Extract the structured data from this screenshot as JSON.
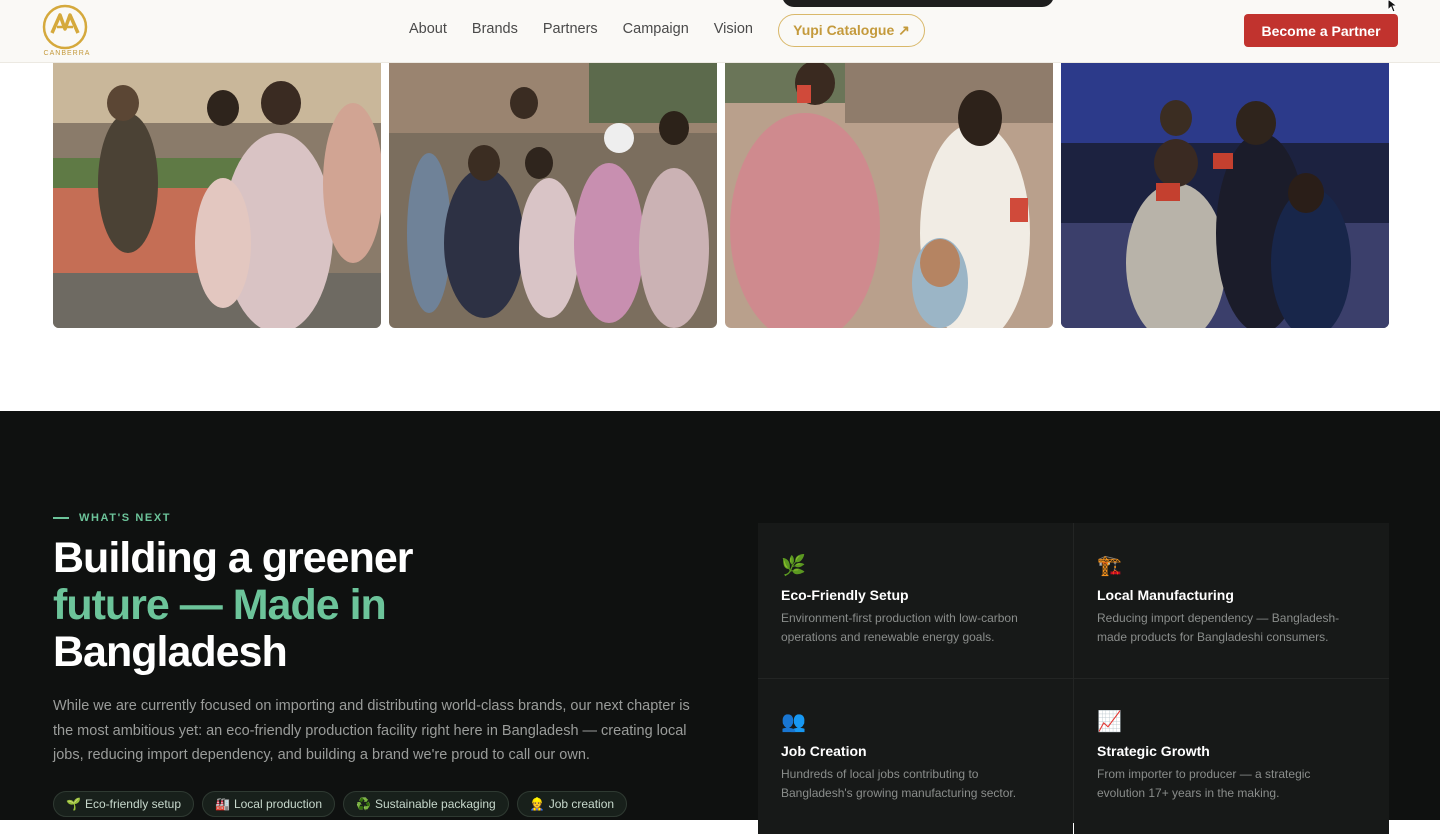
{
  "nav": {
    "logo_text": "CANBERRA",
    "links": [
      "About",
      "Brands",
      "Partners",
      "Campaign",
      "Vision"
    ],
    "catalogue_label": "Yupi Catalogue ↗",
    "partner_label": "Become a Partner",
    "accent": "#c1332e",
    "gold": "#c49a3c"
  },
  "photos": [
    {
      "name": "children-event-photo-1"
    },
    {
      "name": "children-group-photo-2"
    },
    {
      "name": "girls-candy-photo-3"
    },
    {
      "name": "boys-night-event-photo-4"
    }
  ],
  "section": {
    "eyebrow": "WHAT'S NEXT",
    "headline_1": "Building a greener",
    "headline_2": "future — Made in",
    "headline_3": "Bangladesh",
    "description": "While we are currently focused on importing and distributing world-class brands, our next chapter is the most ambitious yet: an eco-friendly production facility right here in Bangladesh — creating local jobs, reducing import dependency, and building a brand we're proud to call our own.",
    "chips": [
      {
        "icon": "🌱",
        "label": "Eco-friendly setup"
      },
      {
        "icon": "🏭",
        "label": "Local production"
      },
      {
        "icon": "♻️",
        "label": "Sustainable packaging"
      },
      {
        "icon": "👷",
        "label": "Job creation"
      }
    ],
    "cards": [
      {
        "icon": "🌿",
        "title": "Eco-Friendly Setup",
        "text": "Environment-first production with low-carbon operations and renewable energy goals."
      },
      {
        "icon": "🏗️",
        "title": "Local Manufacturing",
        "text": "Reducing import dependency — Bangladesh-made products for Bangladeshi consumers."
      },
      {
        "icon": "👥",
        "title": "Job Creation",
        "text": "Hundreds of local jobs contributing to Bangladesh's growing manufacturing sector."
      },
      {
        "icon": "📈",
        "title": "Strategic Growth",
        "text": "From importer to producer — a strategic evolution 17+ years in the making."
      }
    ],
    "green": "#6cc49a"
  }
}
